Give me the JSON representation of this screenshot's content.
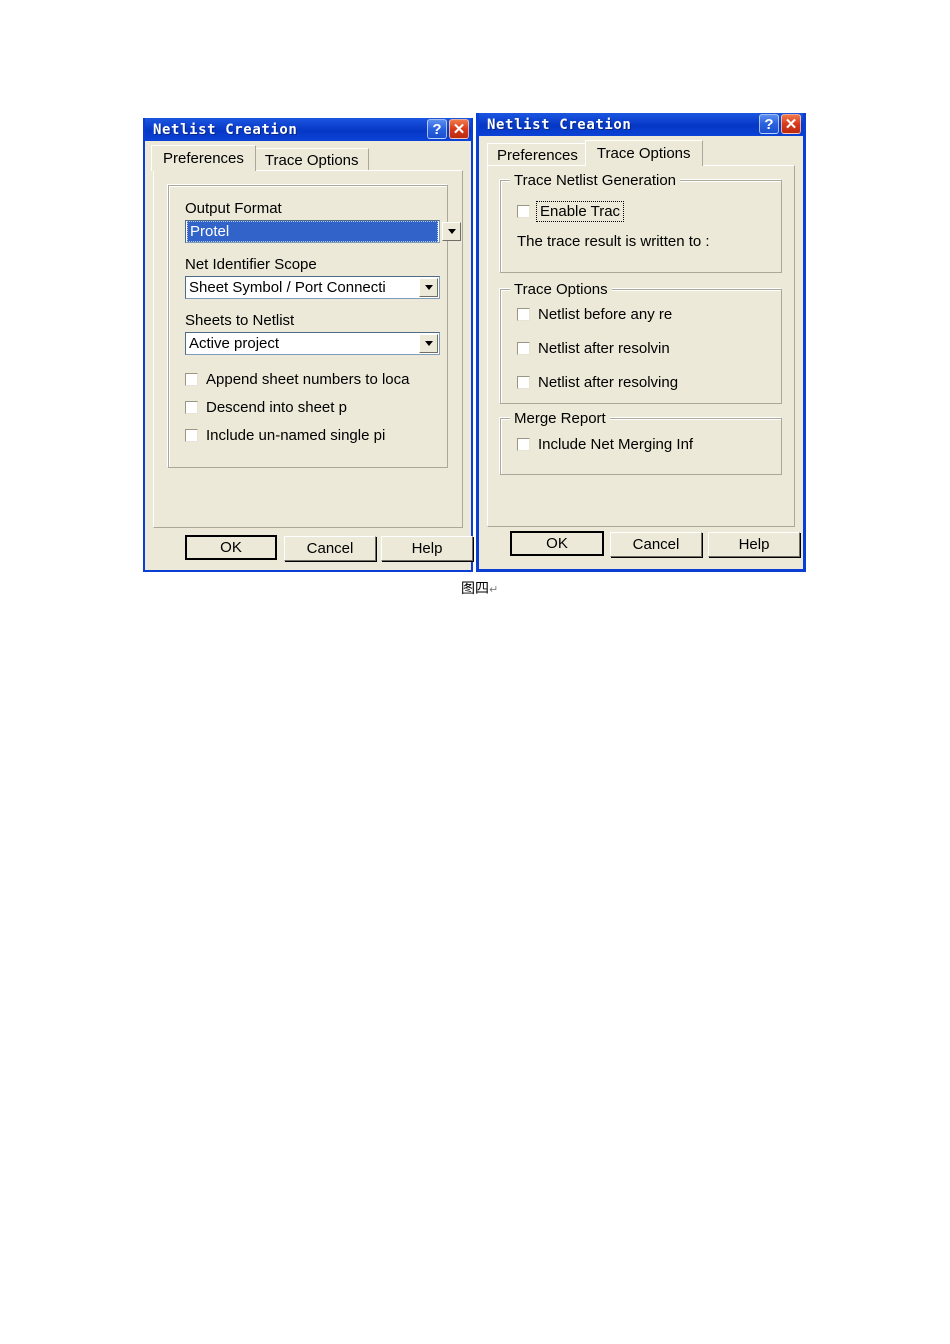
{
  "page": {
    "caption": "图四",
    "caption_mark": "↵"
  },
  "icons": {
    "help": "?",
    "close": "✕",
    "dropdown": "chevron-down-icon"
  },
  "left_dialog": {
    "title": "Netlist Creation",
    "tabs": [
      {
        "label": "Preferences",
        "active": true
      },
      {
        "label": "Trace Options",
        "active": false
      }
    ],
    "fields": [
      {
        "label": "Output Format",
        "value": "Protel",
        "selected": true
      },
      {
        "label": "Net Identifier Scope",
        "value": "Sheet Symbol / Port Connecti",
        "selected": false
      },
      {
        "label": "Sheets to Netlist",
        "value": "Active project",
        "selected": false
      }
    ],
    "checkboxes": [
      {
        "label": "Append sheet numbers to loca",
        "checked": false
      },
      {
        "label": "Descend into sheet p",
        "checked": false
      },
      {
        "label": "Include un-named single pi",
        "checked": false
      }
    ],
    "buttons": [
      {
        "label": "OK",
        "default": true
      },
      {
        "label": "Cancel",
        "default": false
      },
      {
        "label": "Help",
        "default": false
      }
    ]
  },
  "right_dialog": {
    "title": "Netlist Creation",
    "tabs": [
      {
        "label": "Preferences",
        "active": false
      },
      {
        "label": "Trace Options",
        "active": true
      }
    ],
    "groups": [
      {
        "title": "Trace Netlist Generation",
        "checkboxes": [
          {
            "label": "Enable Trac",
            "checked": false,
            "focused": true
          }
        ],
        "text": "The trace result is written to :"
      },
      {
        "title": "Trace Options",
        "checkboxes": [
          {
            "label": "Netlist before any re",
            "checked": false
          },
          {
            "label": "Netlist after resolvin",
            "checked": false
          },
          {
            "label": "Netlist after resolving",
            "checked": false
          }
        ]
      },
      {
        "title": "Merge Report",
        "checkboxes": [
          {
            "label": "Include Net Merging Inf",
            "checked": false
          }
        ]
      }
    ],
    "buttons": [
      {
        "label": "OK",
        "default": true
      },
      {
        "label": "Cancel",
        "default": false
      },
      {
        "label": "Help",
        "default": false
      }
    ]
  },
  "colors": {
    "titlebar_blue": "#0b3fd4",
    "dialog_face": "#ece9d8",
    "selection_blue": "#3163c8",
    "close_red": "#d8391a",
    "frame_gray": "#aca899"
  }
}
